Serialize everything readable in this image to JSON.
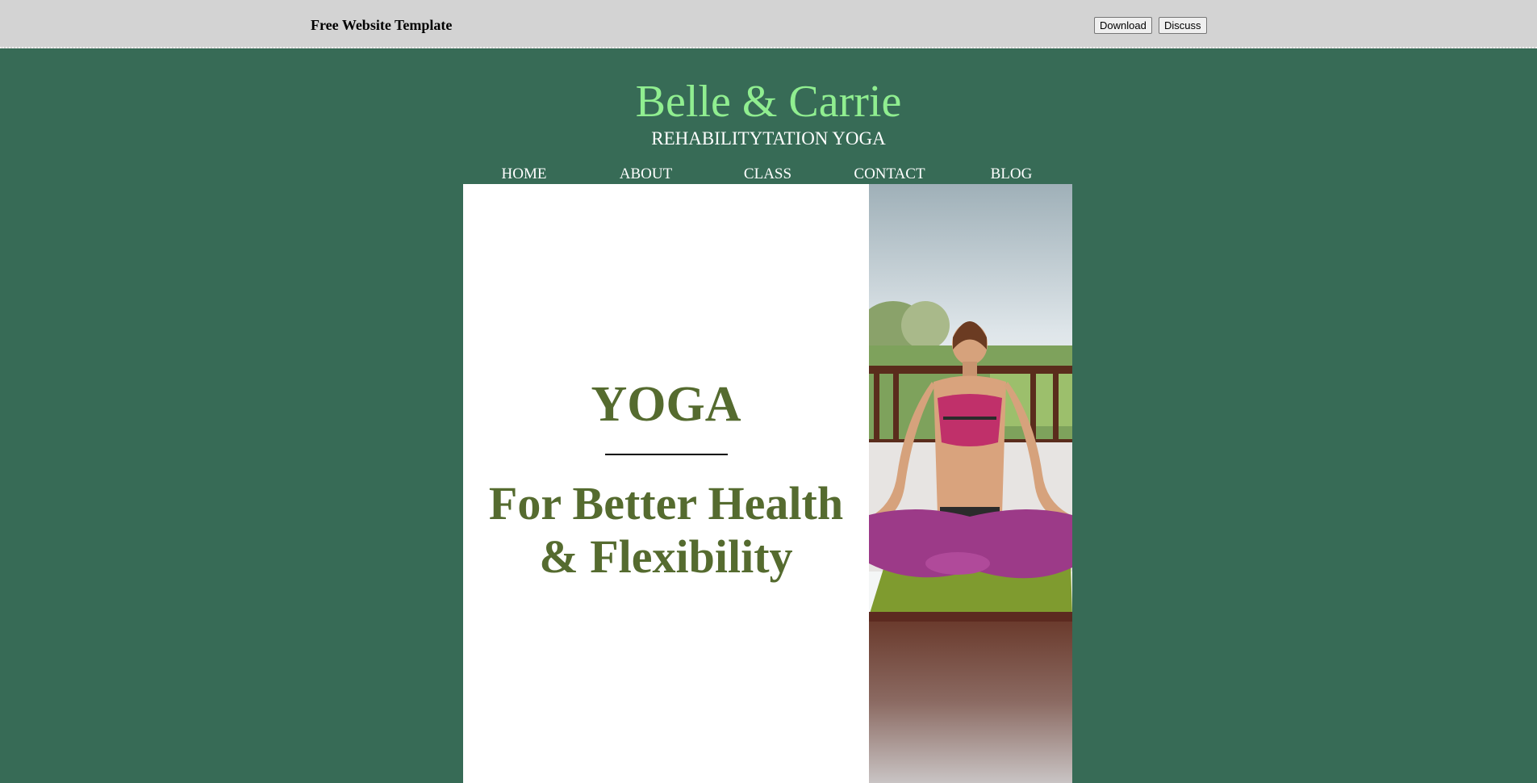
{
  "topbar": {
    "title": "Free Website Template",
    "download_label": "Download",
    "discuss_label": "Discuss"
  },
  "brand": {
    "name": "Belle & Carrie",
    "subtitle": "REHABILITYTATION YOGA"
  },
  "nav": {
    "items": [
      {
        "label": "HOME"
      },
      {
        "label": "ABOUT"
      },
      {
        "label": "CLASS"
      },
      {
        "label": "CONTACT"
      },
      {
        "label": "BLOG"
      }
    ]
  },
  "hero": {
    "title": "YOGA",
    "tagline_line1": "For Better Health",
    "tagline_line2": "& Flexibility",
    "photo_subject": "woman-meditating-lotus-pose"
  },
  "colors": {
    "page_background": "#376b56",
    "topbar_background": "#d3d3d3",
    "brand_green": "#90ee90",
    "hero_text": "#556b2f"
  }
}
